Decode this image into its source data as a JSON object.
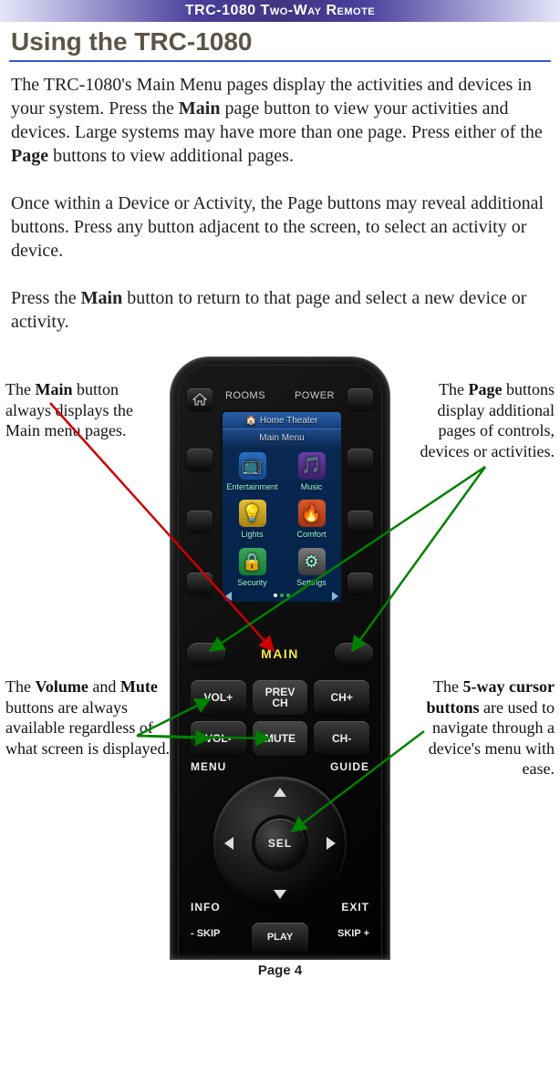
{
  "header": "TRC-1080 Two-Way Remote",
  "title": "Using the TRC-1080",
  "paragraphs": {
    "p1a": "The TRC-1080's Main Menu pages display the activities and devices in your system. Press the ",
    "p1b": "Main",
    "p1c": " page button to view your activities and devices. Large systems may have more than one page. Press either of the ",
    "p1d": "Page",
    "p1e": " buttons to view additional pages.",
    "p2": "Once within a Device or Activity, the Page buttons may reveal additional buttons. Press any button adjacent to the screen, to select an activity or device.",
    "p3a": "Press the ",
    "p3b": "Main",
    "p3c": " button to return to that page and select a new device or activity."
  },
  "callouts": {
    "main": {
      "pre": "The ",
      "bold": "Main",
      "post": " button always displays the Main menu pages."
    },
    "page": {
      "pre": "The ",
      "bold": "Page",
      "post": " buttons display additional pages of controls, devices or activities."
    },
    "volmute": {
      "pre": "The ",
      "bold1": "Volume",
      "mid": " and ",
      "bold2": "Mute",
      "post": " buttons are always available regardless of what screen is displayed."
    },
    "cursor": {
      "pre": "The ",
      "bold": "5-way cursor buttons",
      "post": " are used to navigate through a device's menu with ease."
    }
  },
  "remote": {
    "top_left": "ROOMS",
    "top_right": "POWER",
    "screen": {
      "breadcrumb": "Home Theater",
      "title": "Main Menu",
      "items": [
        "Entertainment",
        "Music",
        "Lights",
        "Comfort",
        "Security",
        "Settings"
      ],
      "icons": [
        "📺",
        "🎵",
        "💡",
        "🔥",
        "🔒",
        "⚙"
      ]
    },
    "main_label": "MAIN",
    "mid": {
      "r1c1": "VOL+",
      "r1c2_a": "PREV",
      "r1c2_b": "CH",
      "r1c3": "CH+",
      "r2c1": "VOL-",
      "r2c2": "MUTE",
      "r2c3": "CH-"
    },
    "row3_left": "MENU",
    "row3_right": "GUIDE",
    "sel": "SEL",
    "row4_left": "INFO",
    "row4_right": "EXIT",
    "play": "PLAY",
    "skip_left": "- SKIP",
    "skip_right": "SKIP +"
  },
  "footer": "Page 4"
}
